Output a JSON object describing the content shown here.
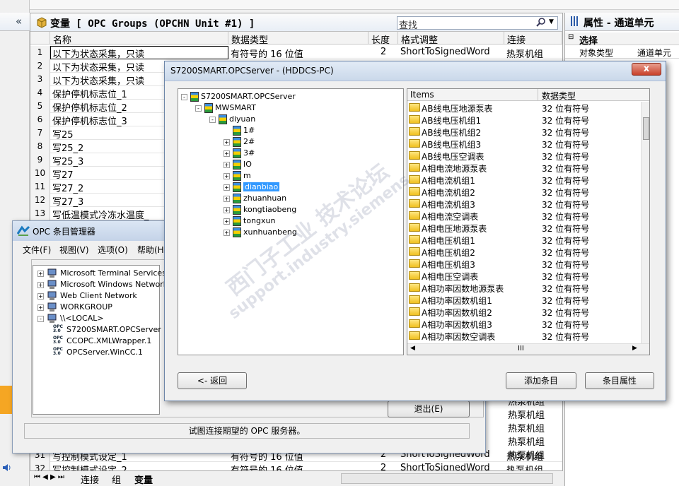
{
  "corner_glyph": "1)",
  "collapse_glyph": "«",
  "grid": {
    "title": "变量 [ OPC Groups (OPCHN Unit #1) ]",
    "search_placeholder": "查找",
    "columns": [
      "名称",
      "数据类型",
      "长度",
      "格式调整",
      "连接"
    ],
    "rows": [
      {
        "n": "1",
        "name": "以下为状态采集，只读",
        "type": "有符号的 16 位值",
        "len": "2",
        "fmt": "ShortToSignedWord",
        "conn": "热泵机组"
      },
      {
        "n": "2",
        "name": "以下为状态采集，只读",
        "type": "",
        "len": "",
        "fmt": "",
        "conn": ""
      },
      {
        "n": "3",
        "name": "以下为状态采集，只读",
        "type": "",
        "len": "",
        "fmt": "",
        "conn": ""
      },
      {
        "n": "4",
        "name": "保护停机标志位_1",
        "type": "",
        "len": "",
        "fmt": "",
        "conn": ""
      },
      {
        "n": "5",
        "name": "保护停机标志位_2",
        "type": "",
        "len": "",
        "fmt": "",
        "conn": ""
      },
      {
        "n": "6",
        "name": "保护停机标志位_3",
        "type": "",
        "len": "",
        "fmt": "",
        "conn": ""
      },
      {
        "n": "7",
        "name": "写25",
        "type": "",
        "len": "",
        "fmt": "",
        "conn": ""
      },
      {
        "n": "8",
        "name": "写25_2",
        "type": "",
        "len": "",
        "fmt": "",
        "conn": ""
      },
      {
        "n": "9",
        "name": "写25_3",
        "type": "",
        "len": "",
        "fmt": "",
        "conn": ""
      },
      {
        "n": "10",
        "name": "写27",
        "type": "",
        "len": "",
        "fmt": "",
        "conn": ""
      },
      {
        "n": "11",
        "name": "写27_2",
        "type": "",
        "len": "",
        "fmt": "",
        "conn": ""
      },
      {
        "n": "12",
        "name": "写27_3",
        "type": "",
        "len": "",
        "fmt": "",
        "conn": ""
      },
      {
        "n": "13",
        "name": "写低温模式冷冻水温度_",
        "type": "",
        "len": "",
        "fmt": "",
        "conn": ""
      }
    ],
    "bottom_rows": [
      {
        "n": "31",
        "name": "写控制模式设定_1",
        "type": "有符号的 16 位值",
        "len": "2",
        "fmt": "ShortToSignedWord",
        "conn": "热泵机组"
      },
      {
        "n": "32",
        "name": "写控制模式设定_2",
        "type": "有符号的 16 位值",
        "len": "2",
        "fmt": "ShortToSignedWord",
        "conn": "热泵机组"
      }
    ],
    "conn_fill": [
      "热泵机组",
      "热泵机组",
      "热泵机组",
      "热泵机组",
      "热泵机组"
    ],
    "tabs": [
      "连接",
      "组",
      "变量"
    ]
  },
  "properties": {
    "title": "属性 - 通道单元",
    "section": "选择",
    "col1": "对象类型",
    "col2": "通道单元"
  },
  "opc_manager": {
    "title": "OPC 条目管理器",
    "menu": [
      "文件(F)",
      "视图(V)",
      "选项(O)",
      "帮助(H)"
    ],
    "tree": [
      {
        "label": "Microsoft Terminal Services",
        "icon": "network-icon"
      },
      {
        "label": "Microsoft Windows Network",
        "icon": "network-icon"
      },
      {
        "label": "Web Client Network",
        "icon": "network-icon"
      },
      {
        "label": "WORKGROUP",
        "icon": "network-icon"
      },
      {
        "label": "\\\\<LOCAL>",
        "icon": "computer-icon"
      },
      {
        "label": "S7200SMART.OPCServer",
        "icon": "opc-icon"
      },
      {
        "label": "CCOPC.XMLWrapper.1",
        "icon": "opc-icon"
      },
      {
        "label": "OPCServer.WinCC.1",
        "icon": "opc-icon"
      }
    ],
    "opc_badge": "OPC",
    "opc_version": "3.0",
    "exit_button": "退出(E)",
    "status": "试图连接期望的 OPC 服务器。"
  },
  "server_dialog": {
    "title": "S7200SMART.OPCServer - (HDDCS-PC)",
    "close_glyph": "x",
    "tree": [
      {
        "label": "S7200SMART.OPCServer",
        "depth": 0,
        "exp": "-"
      },
      {
        "label": "MWSMART",
        "depth": 1,
        "exp": "-"
      },
      {
        "label": "diyuan",
        "depth": 2,
        "exp": "-"
      },
      {
        "label": "1#",
        "depth": 3,
        "exp": ""
      },
      {
        "label": "2#",
        "depth": 3,
        "exp": "+"
      },
      {
        "label": "3#",
        "depth": 3,
        "exp": "+"
      },
      {
        "label": "IO",
        "depth": 3,
        "exp": "+"
      },
      {
        "label": "m",
        "depth": 3,
        "exp": "+"
      },
      {
        "label": "dianbiao",
        "depth": 3,
        "exp": "+",
        "selected": true
      },
      {
        "label": "zhuanhuan",
        "depth": 3,
        "exp": "+"
      },
      {
        "label": "kongtiaobeng",
        "depth": 3,
        "exp": "+"
      },
      {
        "label": "tongxun",
        "depth": 3,
        "exp": "+"
      },
      {
        "label": "xunhuanbeng",
        "depth": 3,
        "exp": "+"
      }
    ],
    "list_headers": [
      "Items",
      "数据类型"
    ],
    "items": [
      [
        "AB线电压地源泵表",
        "32 位有符号"
      ],
      [
        "AB线电压机组1",
        "32 位有符号"
      ],
      [
        "AB线电压机组2",
        "32 位有符号"
      ],
      [
        "AB线电压机组3",
        "32 位有符号"
      ],
      [
        "AB线电压空调表",
        "32 位有符号"
      ],
      [
        "A相电流地源泵表",
        "32 位有符号"
      ],
      [
        "A相电流机组1",
        "32 位有符号"
      ],
      [
        "A相电流机组2",
        "32 位有符号"
      ],
      [
        "A相电流机组3",
        "32 位有符号"
      ],
      [
        "A相电流空调表",
        "32 位有符号"
      ],
      [
        "A相电压地源泵表",
        "32 位有符号"
      ],
      [
        "A相电压机组1",
        "32 位有符号"
      ],
      [
        "A相电压机组2",
        "32 位有符号"
      ],
      [
        "A相电压机组3",
        "32 位有符号"
      ],
      [
        "A相电压空调表",
        "32 位有符号"
      ],
      [
        "A相功率因数地源泵表",
        "32 位有符号"
      ],
      [
        "A相功率因数机组1",
        "32 位有符号"
      ],
      [
        "A相功率因数机组2",
        "32 位有符号"
      ],
      [
        "A相功率因数机组3",
        "32 位有符号"
      ],
      [
        "A相功率因数空调表",
        "32 位有符号"
      ]
    ],
    "scroll_mid": "III",
    "back_button": "<- 返回",
    "add_button": "添加条目",
    "prop_button": "条目属性"
  },
  "watermark": {
    "line1": "西门子工业 技术论坛",
    "line2": "support.industry.siemens"
  }
}
